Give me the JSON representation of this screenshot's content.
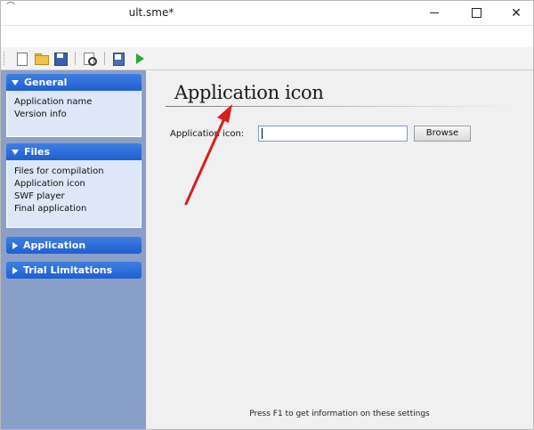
{
  "window": {
    "title": "ult.sme*",
    "app_icon": "app-icon",
    "controls": {
      "minimize_icon": "minimize-icon",
      "maximize_icon": "maximize-icon",
      "close_icon": "close-icon",
      "close_glyph": "✕"
    }
  },
  "toolbar": {
    "buttons": [
      {
        "name": "new-icon"
      },
      {
        "name": "open-folder-icon"
      },
      {
        "name": "save-icon"
      },
      {
        "name": "preview-icon"
      },
      {
        "name": "compile-icon"
      },
      {
        "name": "run-icon"
      }
    ]
  },
  "sidebar": {
    "groups": [
      {
        "label": "General",
        "expanded": true,
        "items": [
          "Application name",
          "Version info"
        ]
      },
      {
        "label": "Files",
        "expanded": true,
        "items": [
          "Files for compilation",
          "Application icon",
          "SWF player",
          "Final application"
        ]
      },
      {
        "label": "Application",
        "expanded": false,
        "items": []
      },
      {
        "label": "Trial Limitations",
        "expanded": false,
        "items": []
      }
    ]
  },
  "main": {
    "title": "Application icon",
    "field_label": "Application icon:",
    "icon_value": "",
    "browse_label": "Browse",
    "hint": "Press F1 to get information on these settings"
  },
  "annotation": {
    "arrow_color": "#d81e1e"
  },
  "colors": {
    "group_header": "#2a6bd8",
    "sidebar_bg": "#8aa0c8",
    "group_body": "#dde7f7",
    "main_bg": "#f0f0f0"
  }
}
